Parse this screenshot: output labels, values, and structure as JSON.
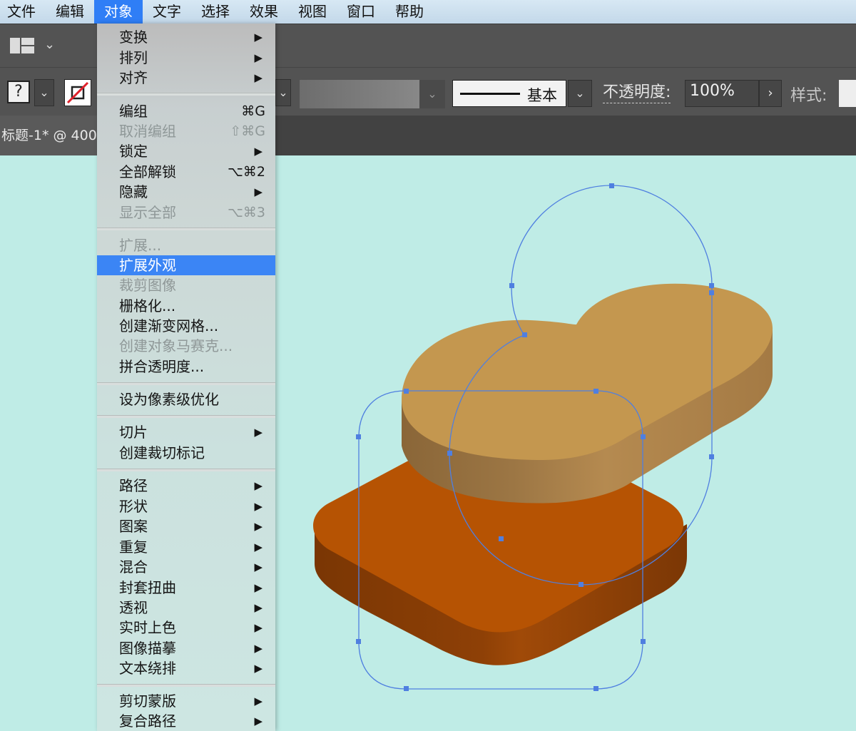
{
  "menubar": [
    "文件",
    "编辑",
    "对象",
    "文字",
    "选择",
    "效果",
    "视图",
    "窗口",
    "帮助"
  ],
  "menubar_active": "对象",
  "control_bar": {
    "unknown_fill": "?",
    "brush": "基本",
    "opacity_label": "不透明度:",
    "opacity_value": "100%",
    "style_label": "样式:"
  },
  "document_tab": "标题-1* @ 400",
  "object_menu": {
    "items": [
      {
        "label": "变换",
        "submenu": true
      },
      {
        "label": "排列",
        "submenu": true
      },
      {
        "label": "对齐",
        "submenu": true
      },
      {
        "label": "编组",
        "shortcut": "⌘G"
      },
      {
        "label": "取消编组",
        "shortcut": "⇧⌘G",
        "disabled": true
      },
      {
        "label": "锁定",
        "submenu": true
      },
      {
        "label": "全部解锁",
        "shortcut": "⌥⌘2"
      },
      {
        "label": "隐藏",
        "submenu": true
      },
      {
        "label": "显示全部",
        "shortcut": "⌥⌘3",
        "disabled": true
      },
      {
        "label": "扩展...",
        "disabled": true
      },
      {
        "label": "扩展外观",
        "highlighted": true
      },
      {
        "label": "裁剪图像",
        "disabled": true
      },
      {
        "label": "栅格化..."
      },
      {
        "label": "创建渐变网格..."
      },
      {
        "label": "创建对象马赛克...",
        "disabled": true
      },
      {
        "label": "拼合透明度..."
      },
      {
        "label": "设为像素级优化"
      },
      {
        "label": "切片",
        "submenu": true
      },
      {
        "label": "创建裁切标记"
      },
      {
        "label": "路径",
        "submenu": true
      },
      {
        "label": "形状",
        "submenu": true
      },
      {
        "label": "图案",
        "submenu": true
      },
      {
        "label": "重复",
        "submenu": true
      },
      {
        "label": "混合",
        "submenu": true
      },
      {
        "label": "封套扭曲",
        "submenu": true
      },
      {
        "label": "透视",
        "submenu": true
      },
      {
        "label": "实时上色",
        "submenu": true
      },
      {
        "label": "图像描摹",
        "submenu": true
      },
      {
        "label": "文本绕排",
        "submenu": true
      },
      {
        "label": "剪切蒙版",
        "submenu": true
      },
      {
        "label": "复合路径",
        "submenu": true
      }
    ]
  },
  "colors": {
    "canvas": "#bfece6",
    "menu_highlight": "#3b85f5",
    "selection": "#4f7fe0",
    "bread_top": "#c4974f",
    "bread_side": "#9e7440",
    "base_top": "#b65303",
    "base_side": "#7c3606"
  }
}
